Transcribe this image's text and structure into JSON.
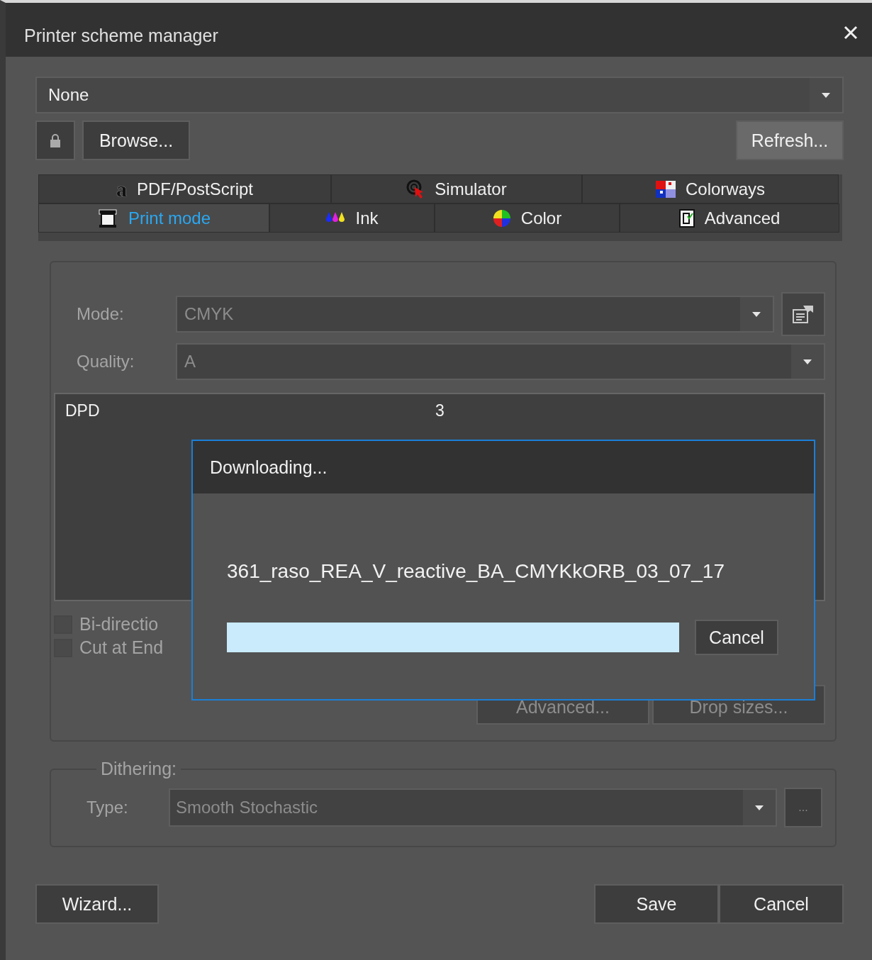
{
  "window": {
    "title": "Printer scheme manager"
  },
  "scheme_select": {
    "value": "None"
  },
  "toolbar": {
    "browse": "Browse...",
    "refresh": "Refresh..."
  },
  "tab_rows": [
    [
      {
        "label": "PDF/PostScript",
        "glyph": "a",
        "selected": false
      },
      {
        "label": "Simulator",
        "selected": false
      },
      {
        "label": "Colorways",
        "selected": false
      }
    ],
    [
      {
        "label": "Print mode",
        "selected": true
      },
      {
        "label": "Ink",
        "selected": false
      },
      {
        "label": "Color",
        "selected": false
      },
      {
        "label": "Advanced",
        "selected": false
      }
    ]
  ],
  "print_mode": {
    "mode": {
      "label": "Mode:",
      "value": "CMYK",
      "disabled": true
    },
    "quality": {
      "label": "Quality:",
      "value": "A",
      "disabled": true
    },
    "table": {
      "rows": [
        {
          "name": "DPD",
          "value": "3"
        }
      ]
    },
    "checkboxes": [
      {
        "label": "Bi-directio",
        "checked": false,
        "disabled": true
      },
      {
        "label": "Cut at End",
        "checked": false,
        "disabled": true
      }
    ],
    "buttons": [
      {
        "label": "Advanced...",
        "disabled": true
      },
      {
        "label": "Drop sizes...",
        "disabled": true
      }
    ]
  },
  "dithering": {
    "legend": "Dithering:",
    "type": {
      "label": "Type:",
      "value": "Smooth Stochastic",
      "disabled": true
    },
    "more": "..."
  },
  "footer": {
    "wizard": "Wizard...",
    "save": "Save",
    "cancel": "Cancel"
  },
  "download_dialog": {
    "title": "Downloading...",
    "file": "361_raso_REA_V_reactive_BA_CMYKkORB_03_07_17",
    "progress": {
      "level": 1
    },
    "cancel": "Cancel"
  }
}
